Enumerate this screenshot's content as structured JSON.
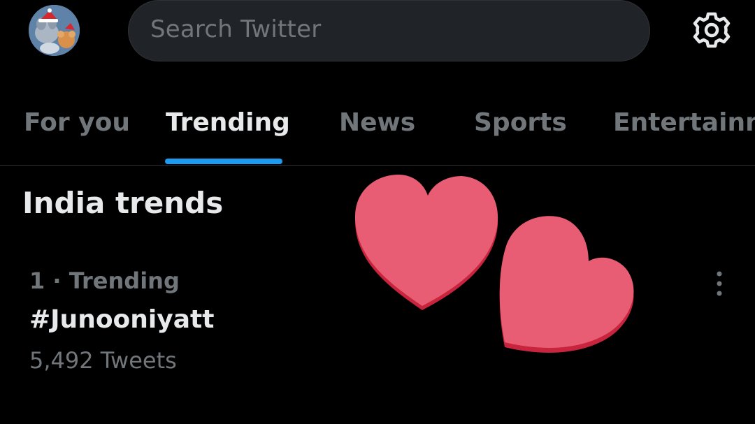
{
  "header": {
    "search_placeholder": "Search Twitter",
    "avatar_icon": "cartoon-avatar",
    "settings_icon": "gear-icon"
  },
  "tabs": [
    {
      "label": "For you",
      "active": false
    },
    {
      "label": "Trending",
      "active": true
    },
    {
      "label": "News",
      "active": false
    },
    {
      "label": "Sports",
      "active": false
    },
    {
      "label": "Entertainment",
      "active": false
    }
  ],
  "section": {
    "title": "India trends"
  },
  "trends": [
    {
      "meta": "1 · Trending",
      "name": "#Junooniyatt",
      "count": "5,492 Tweets",
      "more_icon": "more-vertical-icon"
    }
  ],
  "sticker": {
    "icon": "two-hearts-icon",
    "color": "#e85d73",
    "shadow_color": "#c8243e"
  },
  "colors": {
    "background": "#000000",
    "accent": "#1d9bf0",
    "text_primary": "#e7e9ea",
    "text_secondary": "#71767b",
    "search_bg": "#202327"
  }
}
